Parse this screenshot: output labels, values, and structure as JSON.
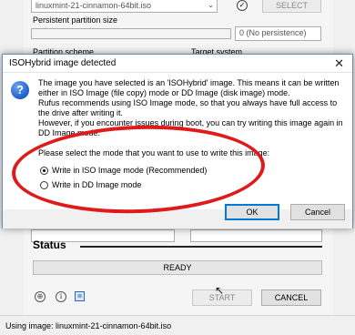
{
  "rufus": {
    "image_combo": "linuxmint-21-cinnamon-64bit.iso",
    "select_label": "SELECT",
    "persistent_label": "Persistent partition size",
    "persistence_value": "0 (No persistence)",
    "partition_scheme_label": "Partition scheme",
    "target_system_label": "Target system",
    "status_heading": "Status",
    "progress_text": "READY",
    "start_label": "START",
    "cancel_label": "CANCEL",
    "status_bar": "Using image: linuxmint-21-cinnamon-64bit.iso"
  },
  "dialog": {
    "title": "ISOHybrid image detected",
    "close_glyph": "✕",
    "message": [
      "The image you have selected is an 'ISOHybrid' image. This means it can be written either in ISO Image (file copy) mode or DD Image (disk image) mode.",
      "Rufus recommends using ISO Image mode, so that you always have full access to the drive after writing it.",
      "However, if you encounter issues during boot, you can try writing this image again in DD Image mode."
    ],
    "prompt": "Please select the mode that you want to use to write this image:",
    "options": [
      {
        "label": "Write in ISO Image mode (Recommended)",
        "selected": true
      },
      {
        "label": "Write in DD Image mode",
        "selected": false
      }
    ],
    "ok_label": "OK",
    "cancel_label": "Cancel"
  },
  "colors": {
    "annotation": "#e01a1a",
    "accent": "#0078d7"
  }
}
